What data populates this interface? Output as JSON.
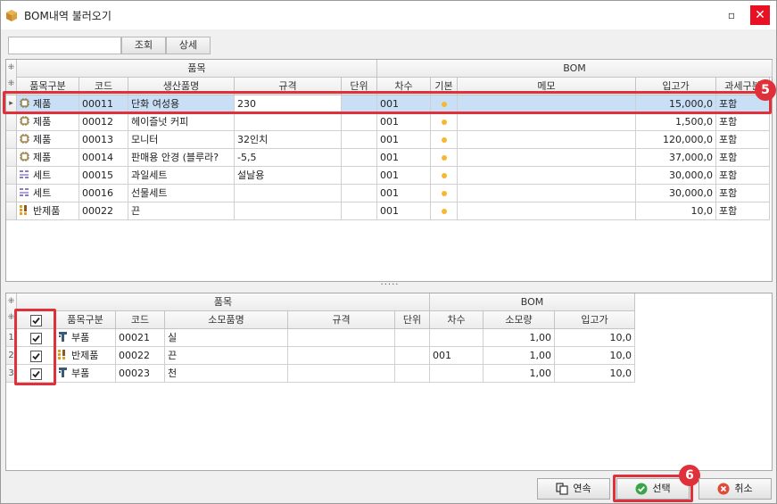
{
  "window": {
    "title": "BOM내역 불러오기",
    "min_glyph": "▫",
    "close_glyph": "✕"
  },
  "toolbar": {
    "search_value": "",
    "search_label": "조회",
    "detail_label": "상세"
  },
  "top_grid": {
    "group_item": "품목",
    "group_bom": "BOM",
    "columns": {
      "type": "품목구분",
      "code": "코드",
      "name": "생산품명",
      "spec": "규격",
      "unit": "단위",
      "seq": "차수",
      "base": "기본",
      "memo": "메모",
      "price": "입고가",
      "tax": "과세구분"
    },
    "rows": [
      {
        "type": "제품",
        "icon": "chip-icon",
        "code": "00011",
        "name": "단화 여성용",
        "spec": "230",
        "unit": "",
        "seq": "001",
        "base": true,
        "memo": "",
        "price": "15,000,0",
        "tax": "포함"
      },
      {
        "type": "제품",
        "icon": "chip-icon",
        "code": "00012",
        "name": "헤이즐넛 커피",
        "spec": "",
        "unit": "",
        "seq": "001",
        "base": true,
        "memo": "",
        "price": "1,500,0",
        "tax": "포함"
      },
      {
        "type": "제품",
        "icon": "chip-icon",
        "code": "00013",
        "name": "모니터",
        "spec": "32인치",
        "unit": "",
        "seq": "001",
        "base": true,
        "memo": "",
        "price": "120,000,0",
        "tax": "포함"
      },
      {
        "type": "제품",
        "icon": "chip-icon",
        "code": "00014",
        "name": "판매용 안경 (블루라?",
        "spec": "-5,5",
        "unit": "",
        "seq": "001",
        "base": true,
        "memo": "",
        "price": "37,000,0",
        "tax": "포함"
      },
      {
        "type": "세트",
        "icon": "set-icon",
        "code": "00015",
        "name": "과일세트",
        "spec": "설날용",
        "unit": "",
        "seq": "001",
        "base": true,
        "memo": "",
        "price": "30,000,0",
        "tax": "포함"
      },
      {
        "type": "세트",
        "icon": "set-icon",
        "code": "00016",
        "name": "선물세트",
        "spec": "",
        "unit": "",
        "seq": "001",
        "base": true,
        "memo": "",
        "price": "30,000,0",
        "tax": "포함"
      },
      {
        "type": "반제품",
        "icon": "semi-icon",
        "code": "00022",
        "name": "끈",
        "spec": "",
        "unit": "",
        "seq": "001",
        "base": true,
        "memo": "",
        "price": "10,0",
        "tax": "포함"
      }
    ]
  },
  "bottom_grid": {
    "group_item": "품목",
    "group_bom": "BOM",
    "columns": {
      "type": "품목구분",
      "code": "코드",
      "name": "소모품명",
      "spec": "규격",
      "unit": "단위",
      "seq": "차수",
      "qty": "소모량",
      "price": "입고가"
    },
    "rows": [
      {
        "no": "1",
        "checked": true,
        "type": "부품",
        "icon": "part-icon",
        "code": "00021",
        "name": "실",
        "spec": "",
        "unit": "",
        "seq": "",
        "qty": "1,00",
        "price": "10,0"
      },
      {
        "no": "2",
        "checked": true,
        "type": "반제품",
        "icon": "semi-icon",
        "code": "00022",
        "name": "끈",
        "spec": "",
        "unit": "",
        "seq": "001",
        "qty": "1,00",
        "price": "10,0"
      },
      {
        "no": "3",
        "checked": true,
        "type": "부품",
        "icon": "part-icon",
        "code": "00023",
        "name": "천",
        "spec": "",
        "unit": "",
        "seq": "",
        "qty": "1,00",
        "price": "10,0"
      }
    ]
  },
  "footer": {
    "continuous_label": "연속",
    "select_label": "선택",
    "cancel_label": "취소"
  },
  "annotations": {
    "badge_top": "5",
    "badge_bottom": "6"
  },
  "colors": {
    "accent_red": "#e0303a",
    "selected_row": "#c8dff5",
    "dot": "#f5b82e"
  }
}
